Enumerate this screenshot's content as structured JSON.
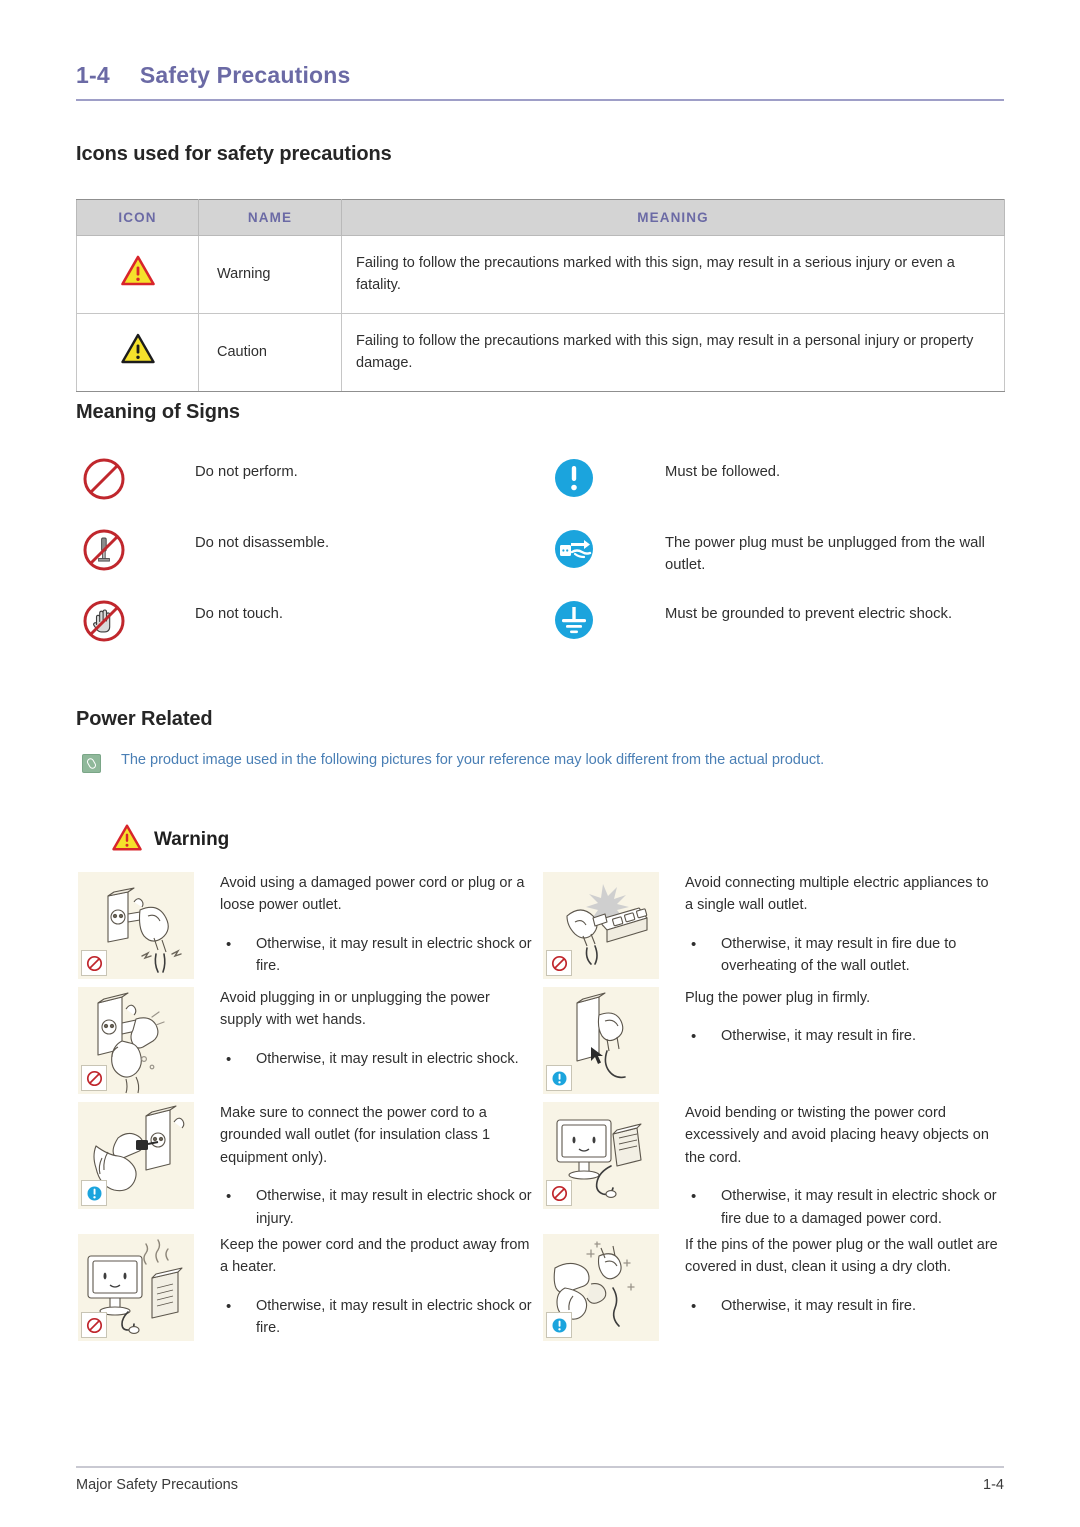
{
  "header": {
    "number": "1-4",
    "title": "Safety Precautions"
  },
  "sections": {
    "icons_heading": "Icons used for safety precautions",
    "signs_heading": "Meaning of Signs",
    "power_heading": "Power Related"
  },
  "icons_table": {
    "columns": [
      "ICON",
      "NAME",
      "MEANING"
    ],
    "rows": [
      {
        "icon": "warning-triangle-red-icon",
        "name": "Warning",
        "meaning": "Failing to follow the precautions marked with this sign, may result in a serious injury or even a fatality."
      },
      {
        "icon": "caution-triangle-yellow-icon",
        "name": "Caution",
        "meaning": "Failing to follow the precautions marked with this sign, may result in a personal injury or property damage."
      }
    ]
  },
  "signs": [
    {
      "icon": "prohibition-circle-icon",
      "text": "Do not perform.",
      "column": "left"
    },
    {
      "icon": "mandatory-exclamation-icon",
      "text": "Must be followed.",
      "column": "right"
    },
    {
      "icon": "no-disassemble-icon",
      "text": "Do not disassemble.",
      "column": "left"
    },
    {
      "icon": "unplug-power-plug-icon",
      "text": "The power plug must be unplugged from the wall outlet.",
      "column": "right"
    },
    {
      "icon": "do-not-touch-hand-icon",
      "text": "Do not touch.",
      "column": "left"
    },
    {
      "icon": "grounding-earth-icon",
      "text": "Must be grounded to prevent electric shock.",
      "column": "right"
    }
  ],
  "note": {
    "icon": "note-clip-icon",
    "text": "The product image used in the following pictures for your reference may look different from the actual product."
  },
  "warning_banner": {
    "icon": "warning-triangle-red-icon",
    "label": "Warning"
  },
  "warnings": [
    {
      "illustration": "damaged-plug-and-loose-outlet-illustration",
      "badge": "prohibition-badge",
      "lead": "Avoid using a damaged power cord or plug or a loose power outlet.",
      "bullet_marker": "•",
      "bullet": "Otherwise, it may result in electric shock or fire."
    },
    {
      "illustration": "multiple-appliances-single-outlet-illustration",
      "badge": "prohibition-badge",
      "lead": "Avoid connecting multiple electric appliances to a single wall outlet.",
      "bullet_marker": "•",
      "bullet": "Otherwise, it may result in fire due to overheating of the wall outlet."
    },
    {
      "illustration": "wet-hands-plug-illustration",
      "badge": "prohibition-badge",
      "lead": "Avoid plugging in or unplugging the power supply with wet hands.",
      "bullet_marker": "•",
      "bullet": "Otherwise, it may result in electric shock."
    },
    {
      "illustration": "plug-in-firmly-illustration",
      "badge": "mandatory-badge",
      "lead": "Plug the power plug in firmly.",
      "bullet_marker": "•",
      "bullet": "Otherwise, it may result in fire."
    },
    {
      "illustration": "grounded-wall-outlet-illustration",
      "badge": "mandatory-badge",
      "lead": "Make sure to connect the power cord to a grounded wall outlet (for insulation class 1 equipment only).",
      "bullet_marker": "•",
      "bullet": "Otherwise, it may result in electric shock or injury."
    },
    {
      "illustration": "bending-cord-heavy-object-illustration",
      "badge": "prohibition-badge",
      "lead": "Avoid bending or twisting the power cord excessively and avoid placing heavy objects on the cord.",
      "bullet_marker": "•",
      "bullet": "Otherwise, it may result in electric shock or fire due to a damaged power cord."
    },
    {
      "illustration": "keep-away-from-heater-illustration",
      "badge": "prohibition-badge",
      "lead": "Keep the power cord and the product away from a heater.",
      "bullet_marker": "•",
      "bullet": "Otherwise, it may result in electric shock or fire."
    },
    {
      "illustration": "clean-dusty-plug-pins-illustration",
      "badge": "mandatory-badge",
      "lead": "If the pins of the power plug or the wall outlet are covered in dust, clean it using a dry cloth.",
      "bullet_marker": "•",
      "bullet": "Otherwise, it may result in fire."
    }
  ],
  "footer": {
    "left": "Major Safety Precautions",
    "right": "1-4"
  },
  "colors": {
    "title_purple": "#6b6aa5",
    "table_header_bg": "#d4d4d4",
    "note_blue": "#4a7fb5",
    "illustration_bg": "#f8f4e6",
    "prohibition_red": "#c0272d",
    "mandatory_blue": "#1ba4dd",
    "caution_yellow": "#f5e12b"
  }
}
